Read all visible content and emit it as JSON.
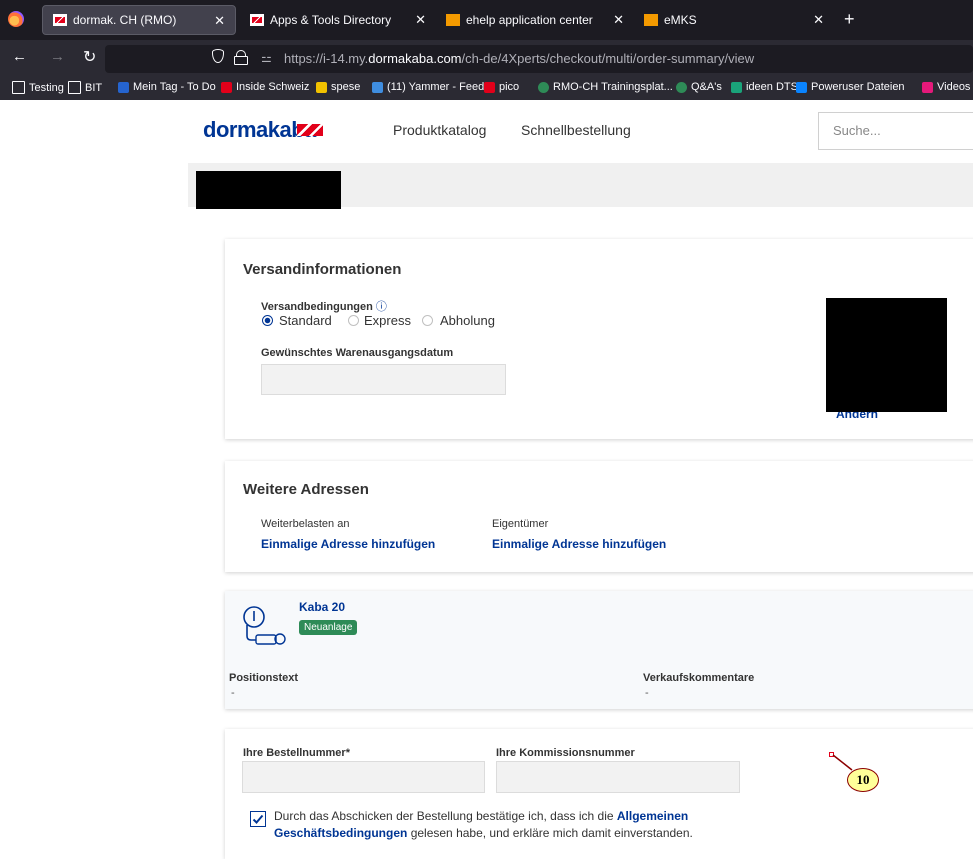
{
  "browser": {
    "tabs": [
      {
        "label": "dormak. CH (RMO)",
        "active": true
      },
      {
        "label": "Apps & Tools Directory",
        "active": false
      },
      {
        "label": "ehelp application center",
        "active": false
      },
      {
        "label": "eMKS",
        "active": false
      }
    ],
    "new_tab": "+",
    "url_prefix": "https://i-14.my.",
    "url_host": "dormakaba.com",
    "url_path": "/ch-de/4Xperts/checkout/multi/order-summary/view",
    "bookmarks": [
      "Testing",
      "BIT",
      "Mein Tag - To Do",
      "Inside Schweiz",
      "spese",
      "(11) Yammer - Feed",
      "pico",
      "RMO-CH Trainingsplat...",
      "Q&A's",
      "ideen DTS",
      "Poweruser Dateien",
      "Videos"
    ]
  },
  "site": {
    "logo": "dormakaba",
    "nav": [
      "Produktkatalog",
      "Schnellbestellung"
    ],
    "search_placeholder": "Suche..."
  },
  "shipping": {
    "title": "Versandinformationen",
    "conditions_label": "Versandbedingungen",
    "options": [
      "Standard",
      "Express",
      "Abholung"
    ],
    "selected": "Standard",
    "date_label": "Gewünschtes Warenausgangsdatum",
    "change_link": "Ändern"
  },
  "addresses": {
    "title": "Weitere Adressen",
    "col1_label": "Weiterbelasten an",
    "col1_link": "Einmalige Adresse hinzufügen",
    "col2_label": "Eigentümer",
    "col2_link": "Einmalige Adresse hinzufügen"
  },
  "item": {
    "name": "Kaba 20",
    "badge": "Neuanlage",
    "position_label": "Positionstext",
    "position_value": "-",
    "comment_label": "Verkaufskommentare",
    "comment_value": "-"
  },
  "order": {
    "order_number_label": "Ihre Bestellnummer*",
    "commission_label": "Ihre Kommissionsnummer",
    "terms_before": "Durch das Abschicken der Bestellung bestätige ich, dass ich die ",
    "terms_link": "Allgemeinen Geschäftsbedingungen",
    "terms_after": " gelesen habe, und erkläre mich damit einverstanden."
  },
  "annotation": {
    "marker": "10"
  }
}
